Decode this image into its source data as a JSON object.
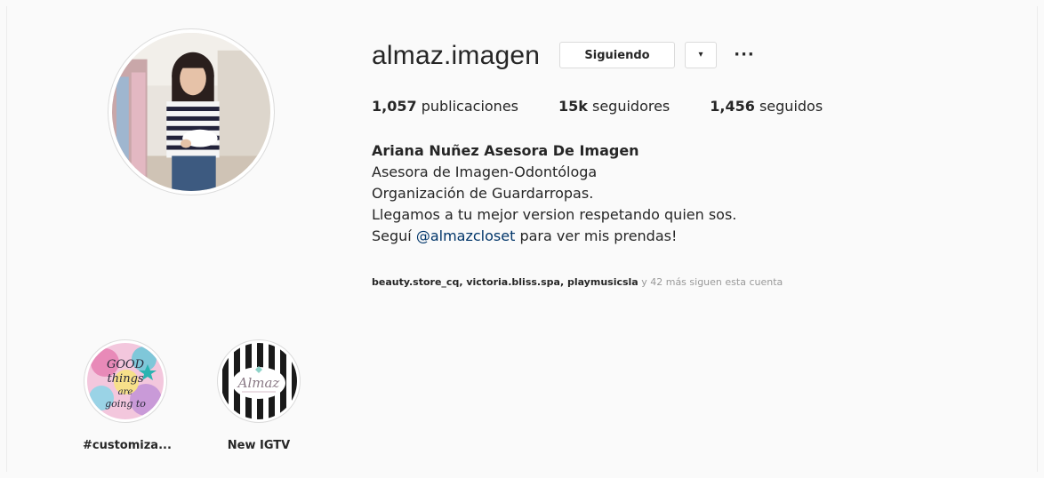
{
  "profile": {
    "username": "almaz.imagen",
    "following_button": "Siguiendo",
    "dropdown_glyph": "▾",
    "more_glyph": "···"
  },
  "stats": {
    "posts_count": "1,057",
    "posts_label": " publicaciones",
    "followers_count": "15k",
    "followers_label": " seguidores",
    "following_count": "1,456",
    "following_label": " seguidos"
  },
  "bio": {
    "full_name": "Ariana Nuñez Asesora De Imagen",
    "line1": "Asesora de Imagen-Odontóloga",
    "line2": "Organización de Guardarropas.",
    "line3": "Llegamos a tu mejor version respetando quien sos.",
    "line4_prefix": "Seguí ",
    "line4_mention": "@almazcloset",
    "line4_suffix": " para ver mis prendas!"
  },
  "followed_by": {
    "users": "beauty.store_cq, victoria.bliss.spa, playmusicsla",
    "suffix": " y 42 más siguen esta cuenta"
  },
  "highlights": [
    {
      "label": "#customiza...",
      "icon": "good-things-highlight-icon",
      "image_text": "GOOD things are going to"
    },
    {
      "label": "New IGTV",
      "icon": "almaz-logo-highlight-icon",
      "image_text": "Almaz"
    }
  ],
  "colors": {
    "background": "#fafafa",
    "text": "#262626",
    "mention": "#003569",
    "muted": "#999999",
    "border": "#dbdbdb"
  }
}
